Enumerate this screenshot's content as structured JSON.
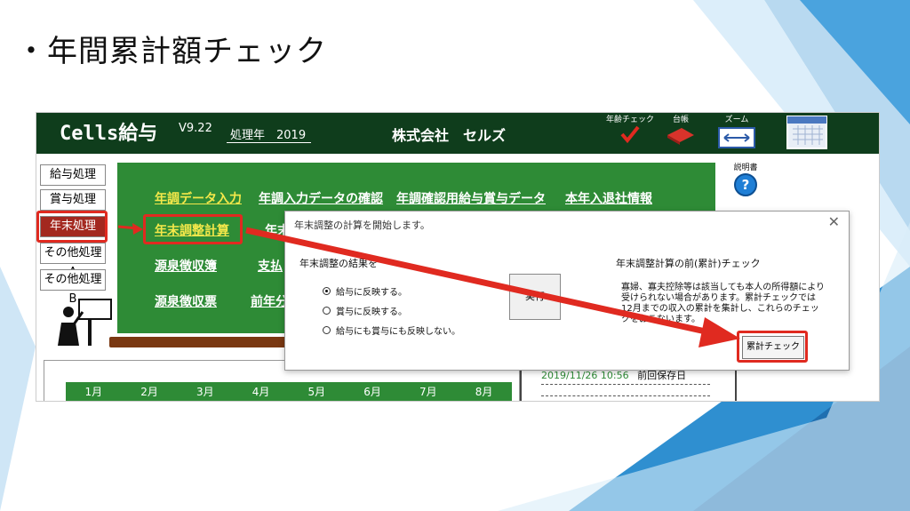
{
  "slide": {
    "title": "・年間累計額チェック"
  },
  "app": {
    "name": "Cells給与",
    "version": "V9.22",
    "year_label": "処理年　2019",
    "company": "株式会社　セルズ",
    "toolbar": {
      "year_check": "年齢チェック",
      "ledger": "台帳",
      "zoom": "ズーム",
      "manual": "説明書"
    }
  },
  "side_menu": {
    "salary": "給与処理",
    "bonus": "賞与処理",
    "year_end": "年末処理",
    "other_a": "その他処理A",
    "other_b": "その他処理B"
  },
  "links": {
    "year_adjust_input": "年調データ入力",
    "confirm_input": "年調入力データの確認",
    "confirm_salary_bonus": "年調確認用給与賞与データ",
    "hires_leavers": "本年入退社情報",
    "calc": "年末調整計算",
    "calc_next": "年末",
    "withholding_book": "源泉徴収簿",
    "payment": "支払",
    "withholding_slip": "源泉徴収票",
    "prev_year": "前年分"
  },
  "calendar": {
    "months": [
      "1月",
      "2月",
      "3月",
      "4月",
      "5月",
      "6月",
      "7月",
      "8月"
    ]
  },
  "right_panel": {
    "saved_datetime": "2019/11/26 10:56",
    "saved_label": "前回保存日"
  },
  "dialog": {
    "title": "年末調整の計算を開始します。",
    "result_label": "年末調整の結果を",
    "options": [
      "給与に反映する。",
      "賞与に反映する。",
      "給与にも賞与にも反映しない。"
    ],
    "selected_index": 0,
    "execute_label": "実行",
    "precheck_label": "年末調整計算の前(累計)チェック",
    "note": "寡婦、寡夫控除等は該当しても本人の所得額により受けられない場合があります。累計チェックでは12月までの収入の累計を集計し、これらのチェックをおこないます。",
    "cum_button": "累計チェック"
  },
  "colors": {
    "app_topbar": "#0f3d1c",
    "menu_green": "#2e8b36",
    "highlight": "#e02a20",
    "link_yellow": "#f4e84a",
    "deco_blue": "#2f8fd0"
  }
}
